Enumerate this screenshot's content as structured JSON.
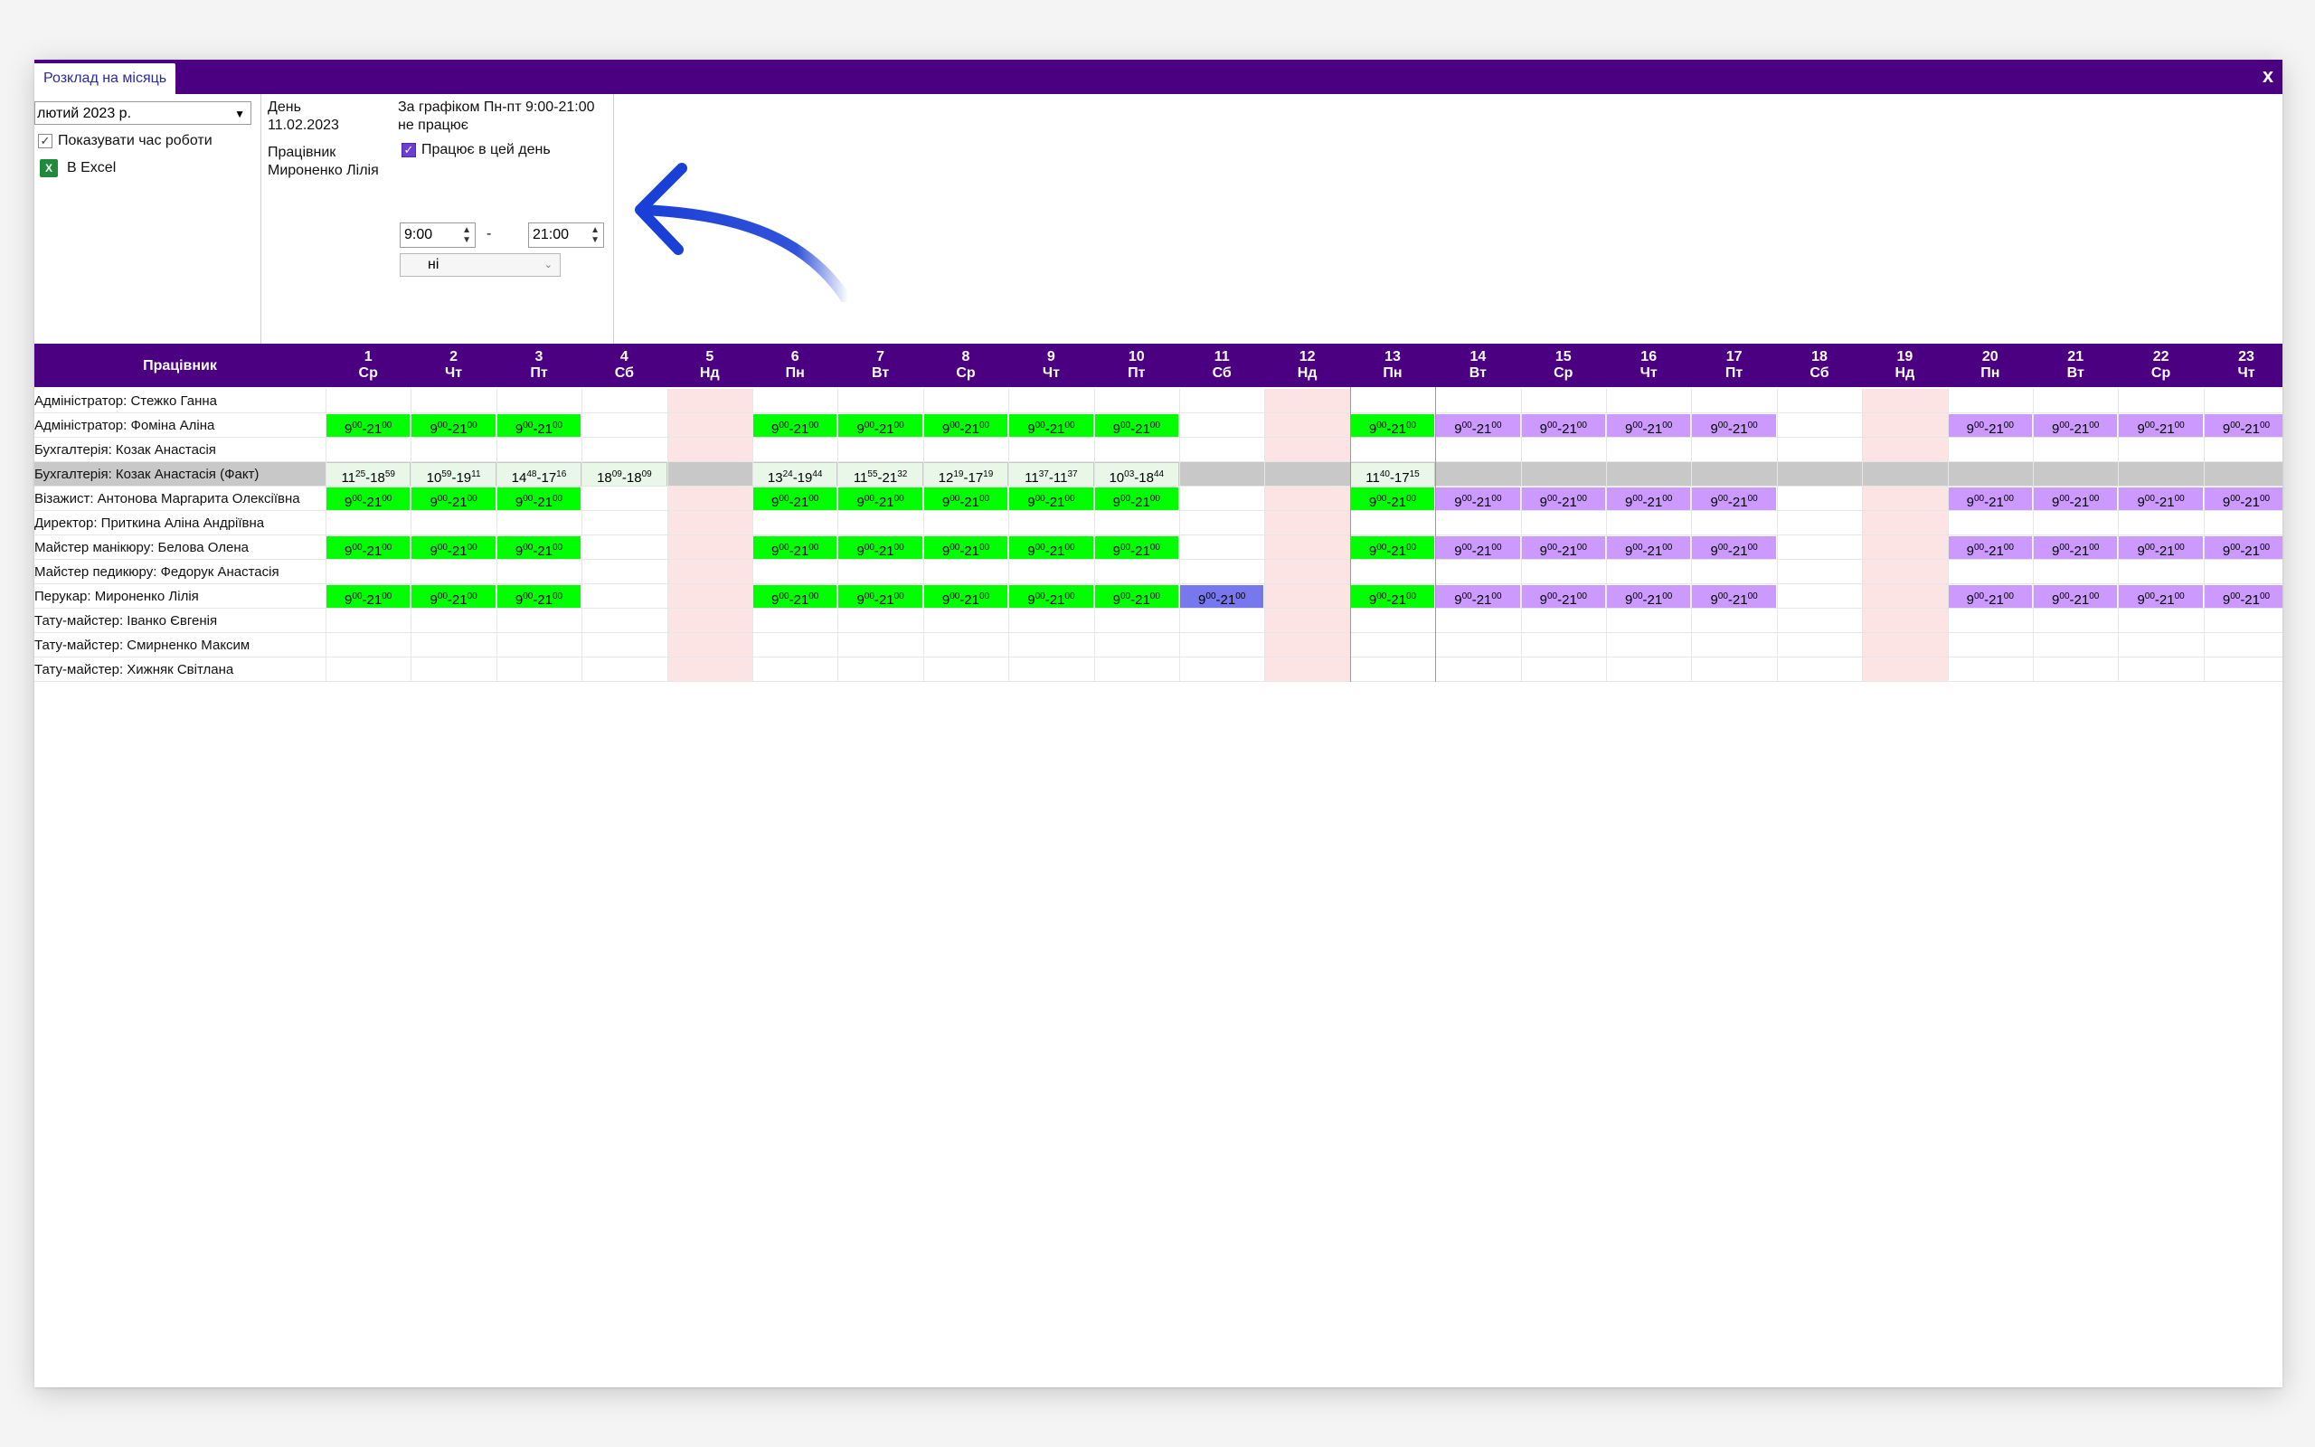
{
  "window": {
    "tab_label": "Розклад на місяць",
    "close_glyph": "x"
  },
  "controls": {
    "month_value": "лютий  2023 р.",
    "show_hours_label": "Показувати час роботи",
    "show_hours_checked": true,
    "excel_label": "В Excel",
    "day_label": "День",
    "day_value": "11.02.2023",
    "employee_label": "Працівник",
    "employee_value": "Мироненко Лілія",
    "schedule_text": "За графіком Пн-пт 9:00-21:00",
    "not_working_text": "не працює",
    "works_today_label": "Працює в цей день",
    "works_today_checked": true,
    "time_from": "9:00",
    "time_dash": "-",
    "time_to": "21:00",
    "extra_select_value": "ні"
  },
  "colors": {
    "header_bg": "#4b0082",
    "planned_green": "#00ff00",
    "future_purple": "#cc99ff",
    "selected_blue": "#7777ee",
    "sunday_pink": "#fce4e4",
    "fact_grey": "#c8c8c8",
    "arrow_blue": "#1a3fd6"
  },
  "grid": {
    "employee_header": "Працівник",
    "days": [
      {
        "n": "1",
        "w": "Ср"
      },
      {
        "n": "2",
        "w": "Чт"
      },
      {
        "n": "3",
        "w": "Пт"
      },
      {
        "n": "4",
        "w": "Сб"
      },
      {
        "n": "5",
        "w": "Нд"
      },
      {
        "n": "6",
        "w": "Пн"
      },
      {
        "n": "7",
        "w": "Вт"
      },
      {
        "n": "8",
        "w": "Ср"
      },
      {
        "n": "9",
        "w": "Чт"
      },
      {
        "n": "10",
        "w": "Пт"
      },
      {
        "n": "11",
        "w": "Сб"
      },
      {
        "n": "12",
        "w": "Нд"
      },
      {
        "n": "13",
        "w": "Пн"
      },
      {
        "n": "14",
        "w": "Вт"
      },
      {
        "n": "15",
        "w": "Ср"
      },
      {
        "n": "16",
        "w": "Чт"
      },
      {
        "n": "17",
        "w": "Пт"
      },
      {
        "n": "18",
        "w": "Сб"
      },
      {
        "n": "19",
        "w": "Нд"
      },
      {
        "n": "20",
        "w": "Пн"
      },
      {
        "n": "21",
        "w": "Вт"
      },
      {
        "n": "22",
        "w": "Ср"
      },
      {
        "n": "23",
        "w": "Чт"
      }
    ],
    "rows": [
      {
        "name": "Адміністратор: Стежко Ганна",
        "type": "empty"
      },
      {
        "name": "Адміністратор: Фоміна Аліна",
        "type": "schedule"
      },
      {
        "name": "Бухгалтерія: Козак Анастасія",
        "type": "empty"
      },
      {
        "name": "Бухгалтерія: Козак Анастасія (Факт)",
        "type": "fact"
      },
      {
        "name": "Візажист: Антонова Маргарита Олексіївна",
        "type": "schedule"
      },
      {
        "name": "Директор: Приткина Аліна Андріївна",
        "type": "empty"
      },
      {
        "name": "Майстер манікюру: Белова Олена",
        "type": "schedule"
      },
      {
        "name": "Майстер педикюру: Федорук Анастасія",
        "type": "empty"
      },
      {
        "name": "Перукар: Мироненко Лілія",
        "type": "schedule_selected"
      },
      {
        "name": "Тату-майстер: Іванко Євгенія",
        "type": "empty"
      },
      {
        "name": "Тату-майстер: Смирненко Максим",
        "type": "empty"
      },
      {
        "name": "Тату-майстер: Хижняк Світлана",
        "type": "empty"
      }
    ],
    "schedule_hours": {
      "start_h": "9",
      "start_m": "00",
      "end_h": "21",
      "end_m": "00"
    },
    "fact_times": {
      "1": [
        "11",
        "25",
        "18",
        "59"
      ],
      "2": [
        "10",
        "59",
        "19",
        "11"
      ],
      "3": [
        "14",
        "48",
        "17",
        "16"
      ],
      "4": [
        "18",
        "09",
        "18",
        "09"
      ],
      "6": [
        "13",
        "24",
        "19",
        "44"
      ],
      "7": [
        "11",
        "55",
        "21",
        "32"
      ],
      "8": [
        "12",
        "19",
        "17",
        "19"
      ],
      "9": [
        "11",
        "37",
        "11",
        "37"
      ],
      "10": [
        "10",
        "03",
        "18",
        "44"
      ],
      "13": [
        "11",
        "40",
        "17",
        "15"
      ]
    },
    "green_days": [
      "1",
      "2",
      "3",
      "6",
      "7",
      "8",
      "9",
      "10",
      "13"
    ],
    "purple_days": [
      "14",
      "15",
      "16",
      "17",
      "20",
      "21",
      "22",
      "23"
    ],
    "selected_day": "11",
    "sunday_days": [
      "5",
      "12",
      "19"
    ]
  }
}
